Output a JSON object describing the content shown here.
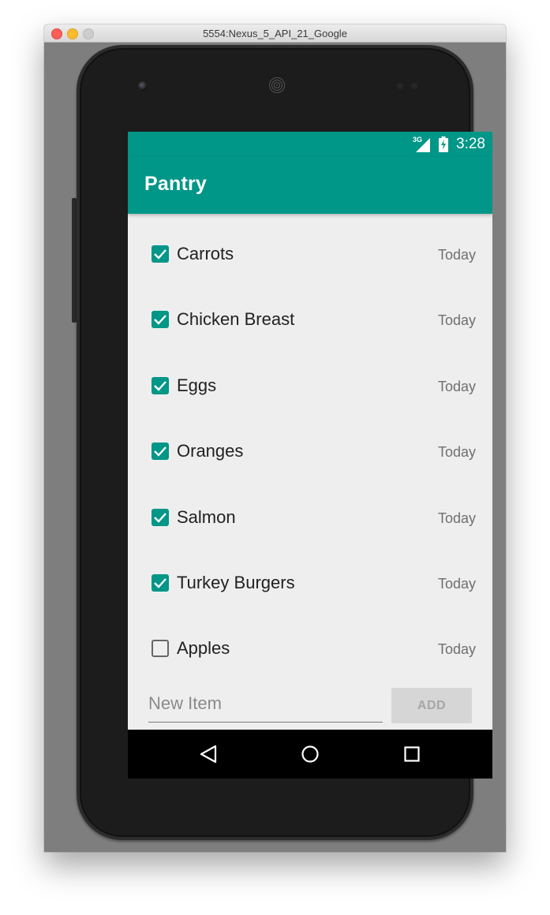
{
  "window": {
    "title": "5554:Nexus_5_API_21_Google"
  },
  "status_bar": {
    "network_label": "3G",
    "time": "3:28",
    "signal_icon": "cell-signal-icon",
    "battery_icon": "battery-charging-icon"
  },
  "toolbar": {
    "title": "Pantry"
  },
  "colors": {
    "primary": "#009688",
    "background": "#eeeeee",
    "nav_bar": "#000000"
  },
  "items": [
    {
      "label": "Carrots",
      "date": "Today",
      "checked": true
    },
    {
      "label": "Chicken Breast",
      "date": "Today",
      "checked": true
    },
    {
      "label": "Eggs",
      "date": "Today",
      "checked": true
    },
    {
      "label": "Oranges",
      "date": "Today",
      "checked": true
    },
    {
      "label": "Salmon",
      "date": "Today",
      "checked": true
    },
    {
      "label": "Turkey Burgers",
      "date": "Today",
      "checked": true
    },
    {
      "label": "Apples",
      "date": "Today",
      "checked": false
    }
  ],
  "new_item": {
    "placeholder": "New Item",
    "value": ""
  },
  "add_button": {
    "label": "ADD"
  },
  "nav": {
    "back_icon": "back-triangle-icon",
    "home_icon": "home-circle-icon",
    "recent_icon": "recent-apps-square-icon"
  }
}
